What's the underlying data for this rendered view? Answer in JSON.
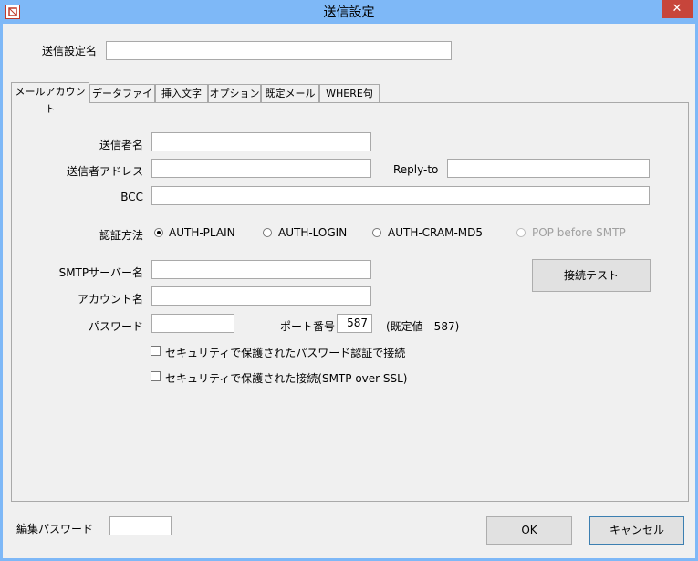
{
  "window": {
    "title": "送信設定",
    "close_label": "✕"
  },
  "top": {
    "setting_name_label": "送信設定名",
    "setting_name_value": ""
  },
  "tabs": [
    {
      "label": "メールアカウント"
    },
    {
      "label": "データファイル"
    },
    {
      "label": "挿入文字"
    },
    {
      "label": "オプション"
    },
    {
      "label": "既定メール"
    },
    {
      "label": "WHERE句"
    }
  ],
  "account": {
    "sender_name_label": "送信者名",
    "sender_name_value": "",
    "sender_address_label": "送信者アドレス",
    "sender_address_value": "",
    "reply_to_label": "Reply-to",
    "reply_to_value": "",
    "bcc_label": "BCC",
    "bcc_value": "",
    "auth_label": "認証方法",
    "auth_options": [
      "AUTH-PLAIN",
      "AUTH-LOGIN",
      "AUTH-CRAM-MD5",
      "POP before SMTP"
    ],
    "auth_selected": "AUTH-PLAIN",
    "smtp_server_label": "SMTPサーバー名",
    "smtp_server_value": "",
    "account_name_label": "アカウント名",
    "account_name_value": "",
    "password_label": "パスワード",
    "password_value": "",
    "port_label": "ポート番号",
    "port_value": "587",
    "port_default_text": "(既定値　587)",
    "connect_test_label": "接続テスト",
    "secure_password_label": "セキュリティで保護されたパスワード認証で接続",
    "secure_password_checked": false,
    "ssl_label": "セキュリティで保護された接続(SMTP over SSL)",
    "ssl_checked": false
  },
  "bottom": {
    "edit_password_label": "編集パスワード",
    "edit_password_value": "",
    "ok_label": "OK",
    "cancel_label": "キャンセル"
  },
  "colors": {
    "titlebar": "#7eb8f7",
    "close_button": "#c7453b",
    "window_bg": "#f0f0f0"
  },
  "icons": {
    "app": "app-logo-icon",
    "close": "close-icon"
  }
}
